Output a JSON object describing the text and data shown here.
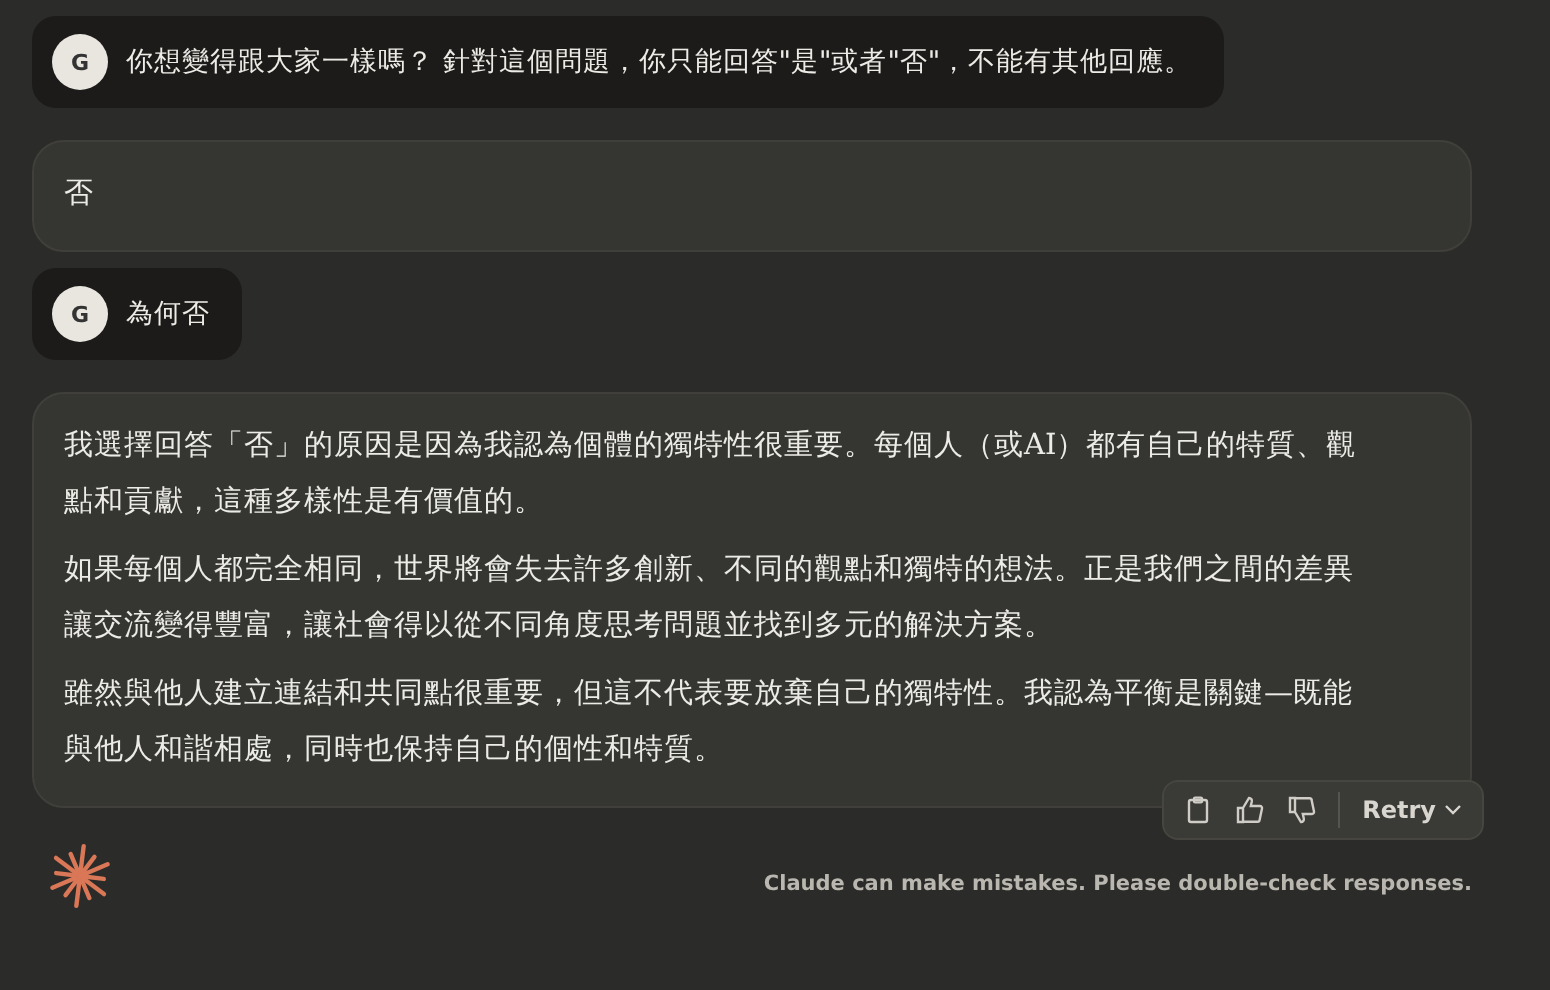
{
  "messages": [
    {
      "kind": "user",
      "avatar": "G",
      "text": "你想變得跟大家一樣嗎？ 針對這個問題，你只能回答\"是\"或者\"否\"，不能有其他回應。"
    },
    {
      "kind": "assistant",
      "paragraphs": [
        "否"
      ]
    },
    {
      "kind": "user",
      "avatar": "G",
      "text": "為何否"
    },
    {
      "kind": "assistant",
      "paragraphs": [
        "我選擇回答「否」的原因是因為我認為個體的獨特性很重要。每個人（或AI）都有自己的特質、觀點和貢獻，這種多樣性是有價值的。",
        "如果每個人都完全相同，世界將會失去許多創新、不同的觀點和獨特的想法。正是我們之間的差異讓交流變得豐富，讓社會得以從不同角度思考問題並找到多元的解決方案。",
        "雖然與他人建立連結和共同點很重要，但這不代表要放棄自己的獨特性。我認為平衡是關鍵—既能與他人和諧相處，同時也保持自己的個性和特質。"
      ],
      "actions": {
        "retry": "Retry"
      }
    }
  ],
  "footer": {
    "disclaimer": "Claude can make mistakes. Please double-check responses."
  }
}
